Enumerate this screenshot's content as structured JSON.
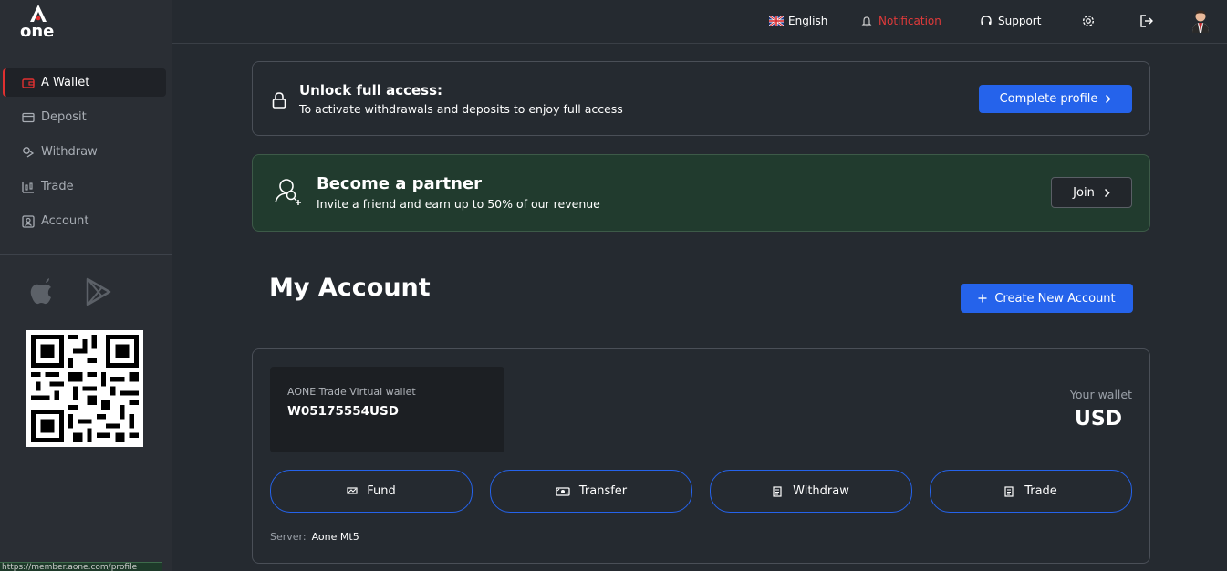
{
  "brand": {
    "logo_text": "one"
  },
  "sidebar": {
    "items": [
      {
        "label": "A Wallet",
        "icon": "wallet-icon",
        "active": true
      },
      {
        "label": "Deposit",
        "icon": "card-icon",
        "active": false
      },
      {
        "label": "Withdraw",
        "icon": "withdraw-icon",
        "active": false
      },
      {
        "label": "Trade",
        "icon": "chart-icon",
        "active": false
      },
      {
        "label": "Account",
        "icon": "account-icon",
        "active": false
      }
    ],
    "stores": [
      "apple-icon",
      "google-play-icon"
    ],
    "status_url": "https://member.aone.com/profile"
  },
  "topbar": {
    "language": "English",
    "notification": "Notification",
    "support": "Support"
  },
  "unlock": {
    "title": "Unlock full access:",
    "subtitle": "To activate withdrawals and deposits to enjoy full access",
    "button": "Complete profile"
  },
  "partner": {
    "title": "Become a partner",
    "subtitle": "Invite a friend and earn up to 50% of our revenue",
    "button": "Join"
  },
  "account": {
    "heading": "My Account",
    "create_button": "Create New Account",
    "wallet_label": "AONE Trade Virtual wallet",
    "wallet_number": "W05175554USD",
    "your_wallet_label": "Your wallet",
    "currency": "USD",
    "actions": [
      "Fund",
      "Transfer",
      "Withdraw",
      "Trade"
    ],
    "server_label": "Server:",
    "server_value": "Aone Mt5"
  },
  "colors": {
    "accent": "#2563eb",
    "brand_red": "#e03030",
    "partner_bg": "#213b2e",
    "bg": "#252a30"
  }
}
